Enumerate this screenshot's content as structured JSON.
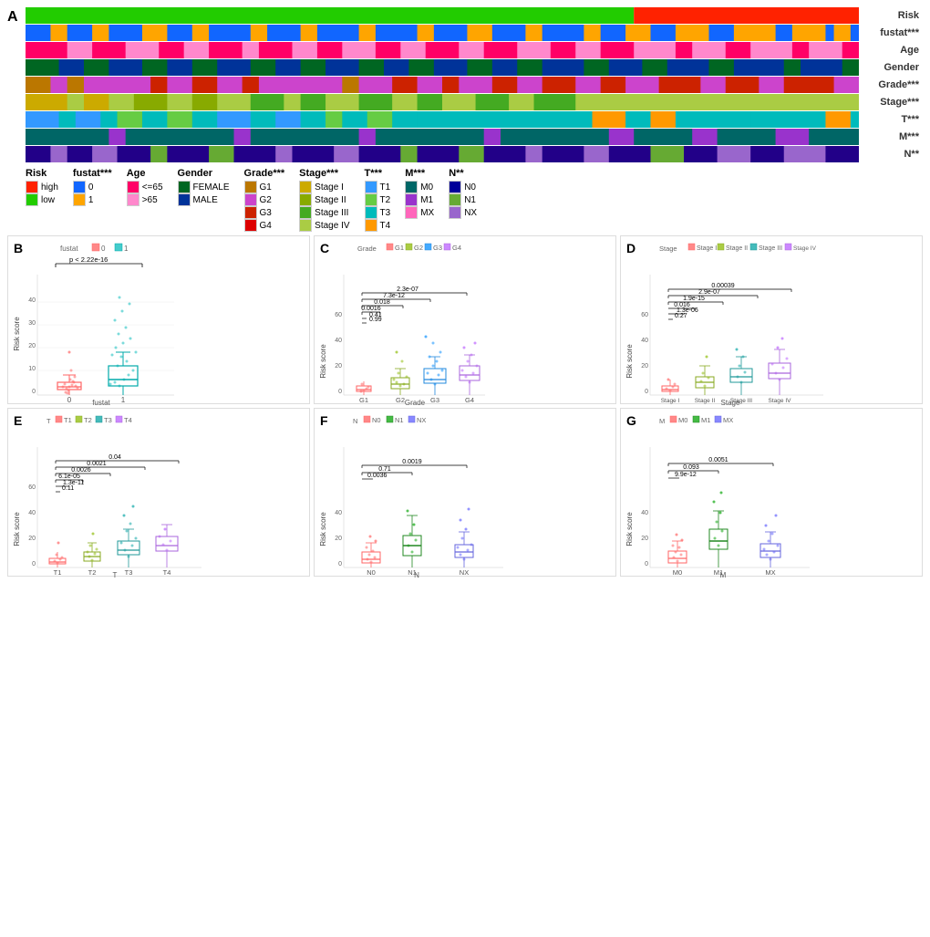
{
  "panels": {
    "a_label": "A",
    "b_label": "B",
    "c_label": "C",
    "d_label": "D",
    "e_label": "E",
    "f_label": "F",
    "g_label": "G"
  },
  "heatmap_rows": [
    {
      "label": "Risk",
      "colors": [
        "green",
        "green",
        "green",
        "green",
        "green",
        "green",
        "green",
        "green",
        "green",
        "green",
        "green",
        "green",
        "green",
        "green",
        "green",
        "green",
        "green",
        "green",
        "green",
        "green",
        "green",
        "green",
        "green",
        "green",
        "green",
        "green",
        "green",
        "green",
        "green",
        "green",
        "green",
        "green",
        "green",
        "green",
        "green",
        "green",
        "green",
        "green",
        "green",
        "green",
        "green",
        "green",
        "green",
        "green",
        "green",
        "green",
        "green",
        "green",
        "green",
        "green",
        "green",
        "green",
        "green",
        "green",
        "green",
        "green",
        "green",
        "green",
        "green",
        "green",
        "green",
        "green",
        "green",
        "green",
        "green",
        "green",
        "green",
        "green",
        "green",
        "green",
        "green",
        "green",
        "green",
        "red",
        "red",
        "red",
        "red",
        "red",
        "red",
        "red",
        "red",
        "red",
        "red",
        "red",
        "red",
        "red",
        "red",
        "red",
        "red",
        "red",
        "red",
        "red",
        "red",
        "red",
        "red",
        "red",
        "red",
        "red",
        "red",
        "red"
      ]
    },
    {
      "label": "fustat***"
    },
    {
      "label": "Age"
    },
    {
      "label": "Gender"
    },
    {
      "label": "Grade***"
    },
    {
      "label": "Stage***"
    },
    {
      "label": "T***"
    },
    {
      "label": "M***"
    },
    {
      "label": "N**"
    }
  ],
  "legend": {
    "risk": {
      "title": "Risk",
      "items": [
        {
          "label": "high",
          "color": "#FF0000"
        },
        {
          "label": "low",
          "color": "#00CC00"
        }
      ]
    },
    "fustat": {
      "title": "fustat***",
      "items": [
        {
          "label": "0",
          "color": "#0070FF"
        },
        {
          "label": "1",
          "color": "#FFA500"
        }
      ]
    },
    "age": {
      "title": "Age",
      "items": [
        {
          "label": "<=65",
          "color": "#FF0090"
        },
        {
          "label": ">65",
          "color": "#FF69B4"
        }
      ]
    },
    "gender": {
      "title": "Gender",
      "items": [
        {
          "label": "FEMALE",
          "color": "#00AA00"
        },
        {
          "label": "MALE",
          "color": "#003399"
        }
      ]
    },
    "grade": {
      "title": "Grade***",
      "items": [
        {
          "label": "G1",
          "color": "#CC8800"
        },
        {
          "label": "G2",
          "color": "#CC44CC"
        },
        {
          "label": "G3",
          "color": "#CC2200"
        },
        {
          "label": "G4",
          "color": "#DD0000"
        }
      ]
    },
    "stage": {
      "title": "Stage***",
      "items": [
        {
          "label": "Stage I",
          "color": "#CCAA00"
        },
        {
          "label": "Stage II",
          "color": "#88AA00"
        },
        {
          "label": "Stage III",
          "color": "#44AA22"
        },
        {
          "label": "Stage IV",
          "color": "#AACC44"
        }
      ]
    },
    "t": {
      "title": "T***",
      "items": [
        {
          "label": "T1",
          "color": "#3399FF"
        },
        {
          "label": "T2",
          "color": "#66CC44"
        },
        {
          "label": "T3",
          "color": "#00CCCC"
        },
        {
          "label": "T4",
          "color": "#FF9900"
        }
      ]
    },
    "m": {
      "title": "M***",
      "items": [
        {
          "label": "M0",
          "color": "#006666"
        },
        {
          "label": "M1",
          "color": "#9933CC"
        },
        {
          "label": "MX",
          "color": "#FF66BB"
        }
      ]
    },
    "n": {
      "title": "N**",
      "items": [
        {
          "label": "N0",
          "color": "#000099"
        },
        {
          "label": "N1",
          "color": "#66AA33"
        },
        {
          "label": "NX",
          "color": "#9966CC"
        }
      ]
    }
  },
  "plots": {
    "b": {
      "title": "fustat",
      "legend": "fustat □ 0 □ 1",
      "pvalue": "p < 2.22e-16",
      "xaxis": "fustat",
      "yaxis": "Risk score",
      "groups": [
        "0",
        "1"
      ]
    },
    "c": {
      "title": "Grade",
      "legend": "Grade □ G1 □ G2 □ G3 □ G4",
      "xaxis": "Grade",
      "yaxis": "Risk score",
      "groups": [
        "G1",
        "G2",
        "G3",
        "G4"
      ],
      "pvalues": [
        "0.99",
        "0.41",
        "0.0016",
        "0.018",
        "7.3e-12",
        "2.3e-07"
      ]
    },
    "d": {
      "title": "Stage",
      "legend": "Stage □ Stage I □ Stage II □ Stage III □ Stage IV",
      "xaxis": "Stage",
      "yaxis": "Risk score",
      "groups": [
        "Stage I",
        "Stage II",
        "Stage III",
        "Stage IV"
      ],
      "pvalues": [
        "0.27",
        "1.3e-06",
        "1.9e-15",
        "0.016",
        "2.9e-07",
        "0.00039"
      ]
    },
    "e": {
      "title": "T",
      "legend": "T □ T1 □ T2 □ T3 □ T4",
      "xaxis": "T",
      "yaxis": "Risk score",
      "groups": [
        "T1",
        "T2",
        "T3",
        "T4"
      ],
      "pvalues": [
        "0.11",
        "1.3e-11",
        "6.1e-05",
        "0.0026",
        "0.0021",
        "0.04"
      ]
    },
    "f": {
      "title": "N",
      "legend": "N □ N0 □ N1 □ NX",
      "xaxis": "N",
      "yaxis": "Risk score",
      "groups": [
        "N0",
        "N1",
        "NX"
      ],
      "pvalues": [
        "0.71",
        "0.0036",
        "0.0019"
      ]
    },
    "g": {
      "title": "M",
      "legend": "M □ M0 □ M1 □ MX",
      "xaxis": "M",
      "yaxis": "Risk score",
      "groups": [
        "M0",
        "M1",
        "MX"
      ],
      "pvalues": [
        "9.9e-12",
        "0.093",
        "0.0051"
      ]
    }
  }
}
